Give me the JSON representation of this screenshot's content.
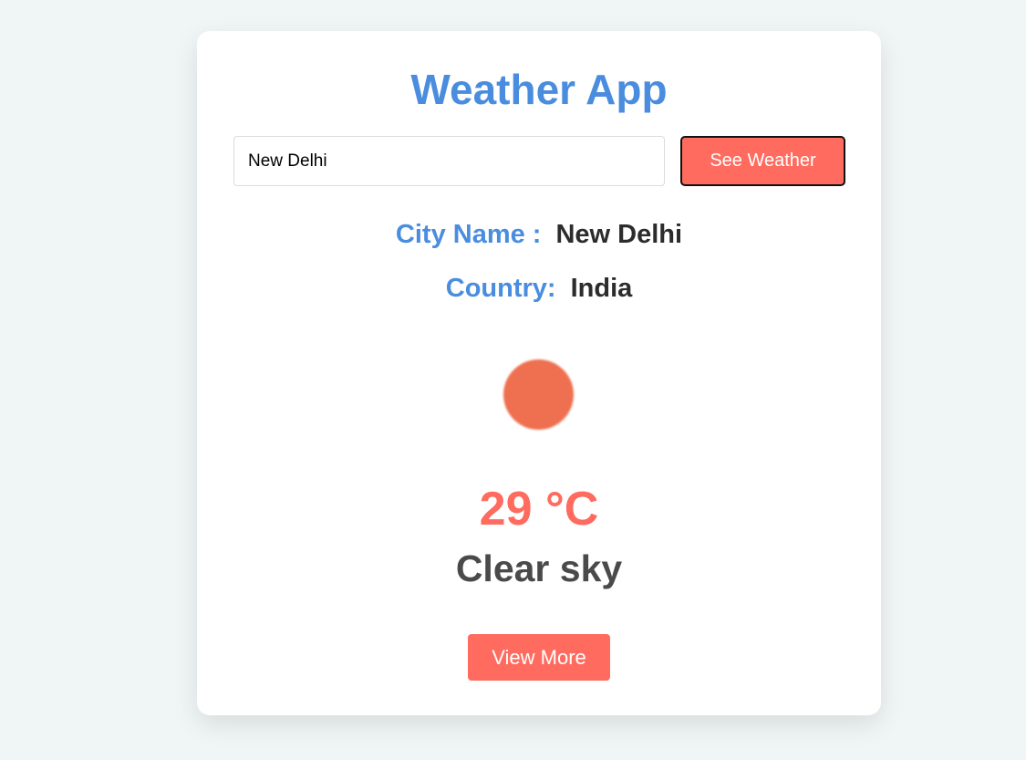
{
  "app": {
    "title": "Weather App"
  },
  "search": {
    "value": "New Delhi",
    "button_label": "See Weather"
  },
  "location": {
    "city_label": "City Name :",
    "city_value": "New Delhi",
    "country_label": "Country:",
    "country_value": "India"
  },
  "weather": {
    "icon": "sun-icon",
    "temperature": "29 °C",
    "description": "Clear sky"
  },
  "actions": {
    "view_more_label": "View More"
  },
  "colors": {
    "accent_blue": "#4a8ddf",
    "accent_red": "#ff6b5e",
    "sun": "#ee7050",
    "background": "#f0f5f5"
  }
}
